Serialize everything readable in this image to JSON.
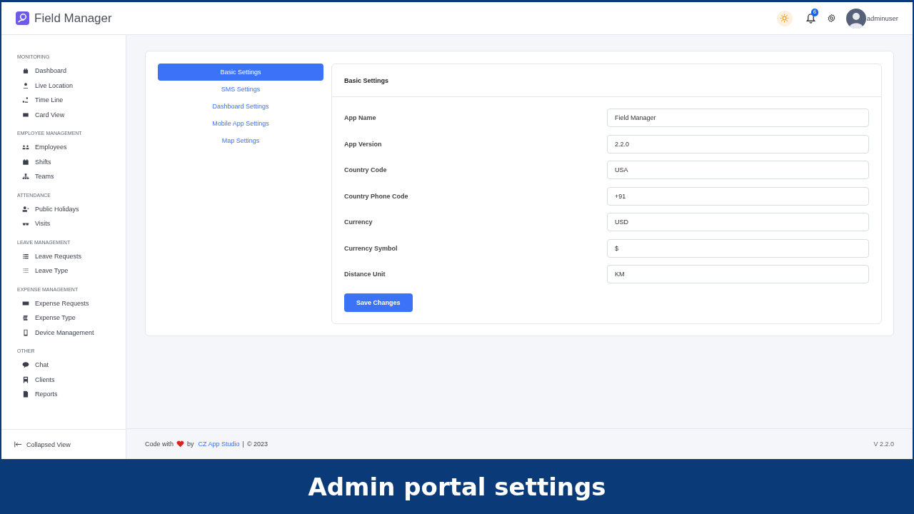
{
  "app": {
    "name": "Field Manager"
  },
  "header": {
    "notification_count": "6",
    "username": "adminuser"
  },
  "sidebar": {
    "sections": [
      {
        "title": "MONITORING",
        "items": [
          {
            "label": "Dashboard"
          },
          {
            "label": "Live Location"
          },
          {
            "label": "Time Line"
          },
          {
            "label": "Card View"
          }
        ]
      },
      {
        "title": "EMPLOYEE MANAGEMENT",
        "items": [
          {
            "label": "Employees"
          },
          {
            "label": "Shifts"
          },
          {
            "label": "Teams"
          }
        ]
      },
      {
        "title": "ATTENDANCE",
        "items": [
          {
            "label": "Public Holidays"
          },
          {
            "label": "Visits"
          }
        ]
      },
      {
        "title": "LEAVE MANAGEMENT",
        "items": [
          {
            "label": "Leave Requests"
          },
          {
            "label": "Leave Type"
          }
        ]
      },
      {
        "title": "EXPENSE MANAGEMENT",
        "items": [
          {
            "label": "Expense Requests"
          },
          {
            "label": "Expense Type"
          },
          {
            "label": "Device Management"
          }
        ]
      },
      {
        "title": "OTHER",
        "items": [
          {
            "label": "Chat"
          },
          {
            "label": "Clients"
          },
          {
            "label": "Reports"
          }
        ]
      }
    ],
    "collapse_label": "Collapsed View"
  },
  "settings_tabs": [
    {
      "label": "Basic Settings",
      "selected": true
    },
    {
      "label": "SMS Settings",
      "selected": false
    },
    {
      "label": "Dashboard Settings",
      "selected": false
    },
    {
      "label": "Mobile App Settings",
      "selected": false
    },
    {
      "label": "Map Settings",
      "selected": false
    }
  ],
  "form": {
    "title": "Basic Settings",
    "fields": [
      {
        "label": "App Name",
        "value": "Field Manager"
      },
      {
        "label": "App Version",
        "value": "2.2.0"
      },
      {
        "label": "Country Code",
        "value": "USA"
      },
      {
        "label": "Country Phone Code",
        "value": "+91"
      },
      {
        "label": "Currency",
        "value": "USD"
      },
      {
        "label": "Currency Symbol",
        "value": "$"
      },
      {
        "label": "Distance Unit",
        "value": "KM"
      }
    ],
    "submit": "Save Changes"
  },
  "footer": {
    "prefix": "Code with",
    "by": "by",
    "link": "CZ App Studio",
    "separator": "|",
    "copyright": "© 2023",
    "version": "V 2.2.0"
  },
  "caption": "Admin portal settings"
}
